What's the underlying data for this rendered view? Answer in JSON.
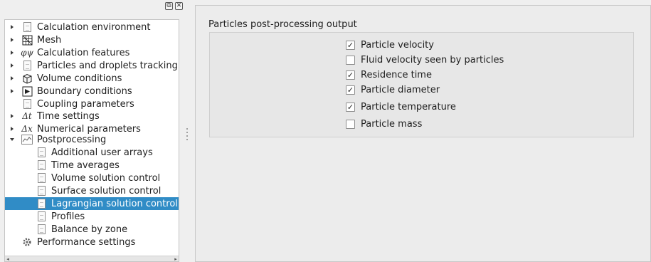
{
  "dock": {
    "float_glyph": "⧉",
    "close_glyph": "✕"
  },
  "tree": {
    "items": [
      {
        "label": "Calculation environment",
        "icon": "document-icon",
        "expand": "right"
      },
      {
        "label": "Mesh",
        "icon": "mesh-icon",
        "expand": "right"
      },
      {
        "label": "Calculation features",
        "icon": "phi-psi-icon",
        "glyph": "φψ",
        "expand": "right"
      },
      {
        "label": "Particles and droplets tracking",
        "icon": "document-icon",
        "expand": "right"
      },
      {
        "label": "Volume conditions",
        "icon": "cube-icon",
        "expand": "right"
      },
      {
        "label": "Boundary conditions",
        "icon": "boundary-icon",
        "expand": "right"
      },
      {
        "label": "Coupling parameters",
        "icon": "document-icon",
        "expand": "none"
      },
      {
        "label": "Time settings",
        "icon": "delta-t-icon",
        "glyph": "Δt",
        "expand": "right"
      },
      {
        "label": "Numerical parameters",
        "icon": "delta-x-icon",
        "glyph": "Δx",
        "expand": "right"
      },
      {
        "label": "Postprocessing",
        "icon": "chart-icon",
        "expand": "down"
      },
      {
        "label": "Additional user arrays",
        "icon": "document-icon",
        "expand": "none",
        "child": true
      },
      {
        "label": "Time averages",
        "icon": "document-icon",
        "expand": "none",
        "child": true
      },
      {
        "label": "Volume solution control",
        "icon": "document-icon",
        "expand": "none",
        "child": true
      },
      {
        "label": "Surface solution control",
        "icon": "document-icon",
        "expand": "none",
        "child": true
      },
      {
        "label": "Lagrangian solution control",
        "icon": "document-icon",
        "expand": "none",
        "child": true,
        "selected": true
      },
      {
        "label": "Profiles",
        "icon": "document-icon",
        "expand": "none",
        "child": true
      },
      {
        "label": "Balance by zone",
        "icon": "document-icon",
        "expand": "none",
        "child": true
      },
      {
        "label": "Performance settings",
        "icon": "gear-icon",
        "expand": "none"
      }
    ]
  },
  "panel": {
    "group_title": "Particles post-processing output",
    "options": [
      {
        "label": "Particle velocity",
        "checked": true
      },
      {
        "label": "Fluid velocity seen by particles",
        "checked": false
      },
      {
        "label": "Residence time",
        "checked": true
      },
      {
        "label": "Particle diameter",
        "checked": true
      },
      {
        "label": "Particle temperature",
        "checked": true
      },
      {
        "label": "Particle mass",
        "checked": false
      }
    ]
  },
  "colors": {
    "selection": "#308cc6",
    "selection_text": "#ffffff"
  }
}
